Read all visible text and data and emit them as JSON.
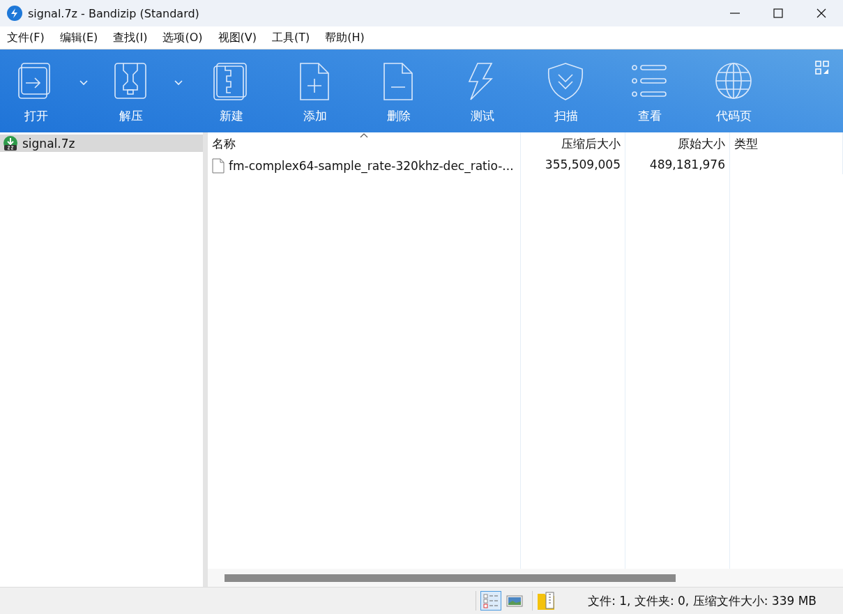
{
  "window": {
    "title": "signal.7z - Bandizip (Standard)"
  },
  "menu": [
    "文件(F)",
    "编辑(E)",
    "查找(I)",
    "选项(O)",
    "视图(V)",
    "工具(T)",
    "帮助(H)"
  ],
  "toolbar": [
    {
      "label": "打开",
      "dropdown": true
    },
    {
      "label": "解压",
      "dropdown": true
    },
    {
      "label": "新建",
      "dropdown": false
    },
    {
      "label": "添加",
      "dropdown": false
    },
    {
      "label": "删除",
      "dropdown": false
    },
    {
      "label": "测试",
      "dropdown": false
    },
    {
      "label": "扫描",
      "dropdown": false
    },
    {
      "label": "查看",
      "dropdown": false
    },
    {
      "label": "代码页",
      "dropdown": false
    }
  ],
  "tree": [
    {
      "label": "signal.7z",
      "selected": true
    }
  ],
  "table": {
    "columns": [
      {
        "label": "名称",
        "sorted": true,
        "kind": "text"
      },
      {
        "label": "压缩后大小",
        "sorted": false,
        "kind": "number"
      },
      {
        "label": "原始大小",
        "sorted": false,
        "kind": "number"
      },
      {
        "label": "类型",
        "sorted": false,
        "kind": "text"
      }
    ],
    "rows": [
      {
        "cells": [
          "fm-complex64-sample_rate-320khz-dec_ratio-...",
          "355,509,005",
          "489,181,976"
        ]
      }
    ]
  },
  "status_bar": {
    "views": [
      {
        "selected": true
      },
      {
        "selected": false
      }
    ],
    "text": "文件: 1, 文件夹: 0, 压缩文件大小: 339 MB"
  }
}
